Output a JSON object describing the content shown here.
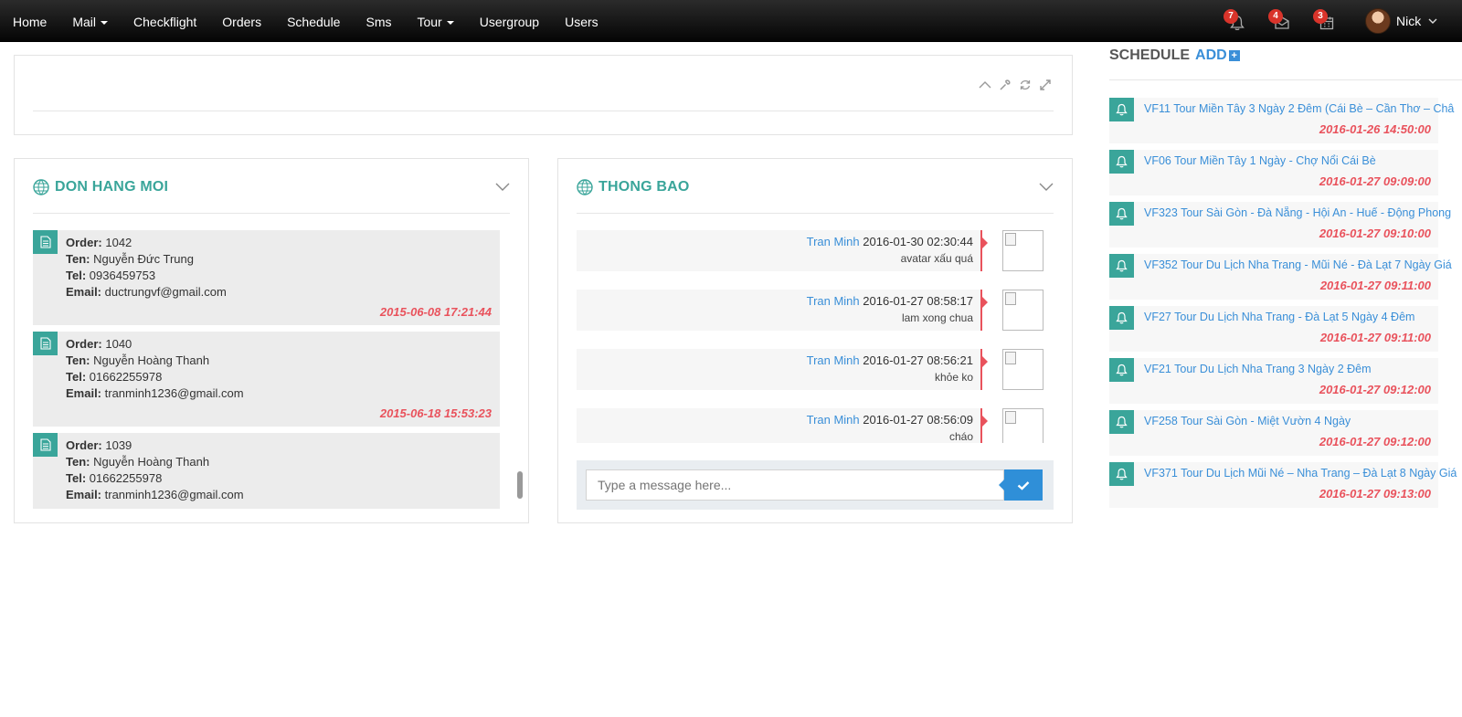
{
  "nav": {
    "items": [
      {
        "label": "Home",
        "dropdown": false
      },
      {
        "label": "Mail",
        "dropdown": true
      },
      {
        "label": "Checkflight",
        "dropdown": false
      },
      {
        "label": "Orders",
        "dropdown": false
      },
      {
        "label": "Schedule",
        "dropdown": false
      },
      {
        "label": "Sms",
        "dropdown": false
      },
      {
        "label": "Tour",
        "dropdown": true
      },
      {
        "label": "Usergroup",
        "dropdown": false
      },
      {
        "label": "Users",
        "dropdown": false
      }
    ],
    "notifications": [
      {
        "icon": "bell-icon",
        "count": "7"
      },
      {
        "icon": "envelope-icon",
        "count": "4"
      },
      {
        "icon": "calendar-icon",
        "count": "3"
      }
    ],
    "user_name": "Nick"
  },
  "orders_box": {
    "title": "DON HANG MOI",
    "labels": {
      "order": "Order:",
      "name": "Ten:",
      "tel": "Tel:",
      "email": "Email:"
    },
    "orders": [
      {
        "order": "1042",
        "name": "Nguyễn Đức Trung",
        "tel": "0936459753",
        "email": "ductrungvf@gmail.com",
        "time": "2015-06-08 17:21:44"
      },
      {
        "order": "1040",
        "name": "Nguyễn Hoàng Thanh",
        "tel": "01662255978",
        "email": "tranminh1236@gmail.com",
        "time": "2015-06-18 15:53:23"
      },
      {
        "order": "1039",
        "name": "Nguyễn Hoàng Thanh",
        "tel": "01662255978",
        "email": "tranminh1236@gmail.com",
        "time": ""
      }
    ]
  },
  "messages_box": {
    "title": "THONG BAO",
    "messages": [
      {
        "author": "Tran Minh",
        "time": "2016-01-30 02:30:44",
        "text": "avatar xấu quá"
      },
      {
        "author": "Tran Minh",
        "time": "2016-01-27 08:58:17",
        "text": "lam xong chua"
      },
      {
        "author": "Tran Minh",
        "time": "2016-01-27 08:56:21",
        "text": "khỏe ko"
      },
      {
        "author": "Tran Minh",
        "time": "2016-01-27 08:56:09",
        "text": "cháo"
      }
    ],
    "input_placeholder": "Type a message here..."
  },
  "schedule": {
    "label": "SCHEDULE",
    "add_label": "ADD",
    "items": [
      {
        "title": "VF11 Tour Miền Tây 3 Ngày 2 Đêm (Cái Bè – Cần Thơ – Châ",
        "time": "2016-01-26 14:50:00"
      },
      {
        "title": "VF06 Tour Miền Tây 1 Ngày - Chợ Nổi Cái Bè",
        "time": "2016-01-27 09:09:00"
      },
      {
        "title": "VF323 Tour Sài Gòn - Đà Nẵng - Hội An - Huế - Động Phong",
        "time": "2016-01-27 09:10:00"
      },
      {
        "title": "VF352 Tour Du Lịch Nha Trang - Mũi Né - Đà Lạt 7 Ngày Giá",
        "time": "2016-01-27 09:11:00"
      },
      {
        "title": "VF27 Tour Du Lịch Nha Trang - Đà Lạt 5 Ngày 4 Đêm",
        "time": "2016-01-27 09:11:00"
      },
      {
        "title": "VF21 Tour Du Lịch Nha Trang 3 Ngày 2 Đêm",
        "time": "2016-01-27 09:12:00"
      },
      {
        "title": "VF258 Tour Sài Gòn - Miệt Vườn 4 Ngày",
        "time": "2016-01-27 09:12:00"
      },
      {
        "title": "VF371 Tour Du Lịch Mũi Né – Nha Trang – Đà Lạt 8 Ngày Giá",
        "time": "2016-01-27 09:13:00"
      }
    ]
  },
  "colors": {
    "accent": "#3aa59a",
    "link": "#3a8fd8",
    "timestamp": "#e9525c",
    "badge": "#d9342b"
  }
}
